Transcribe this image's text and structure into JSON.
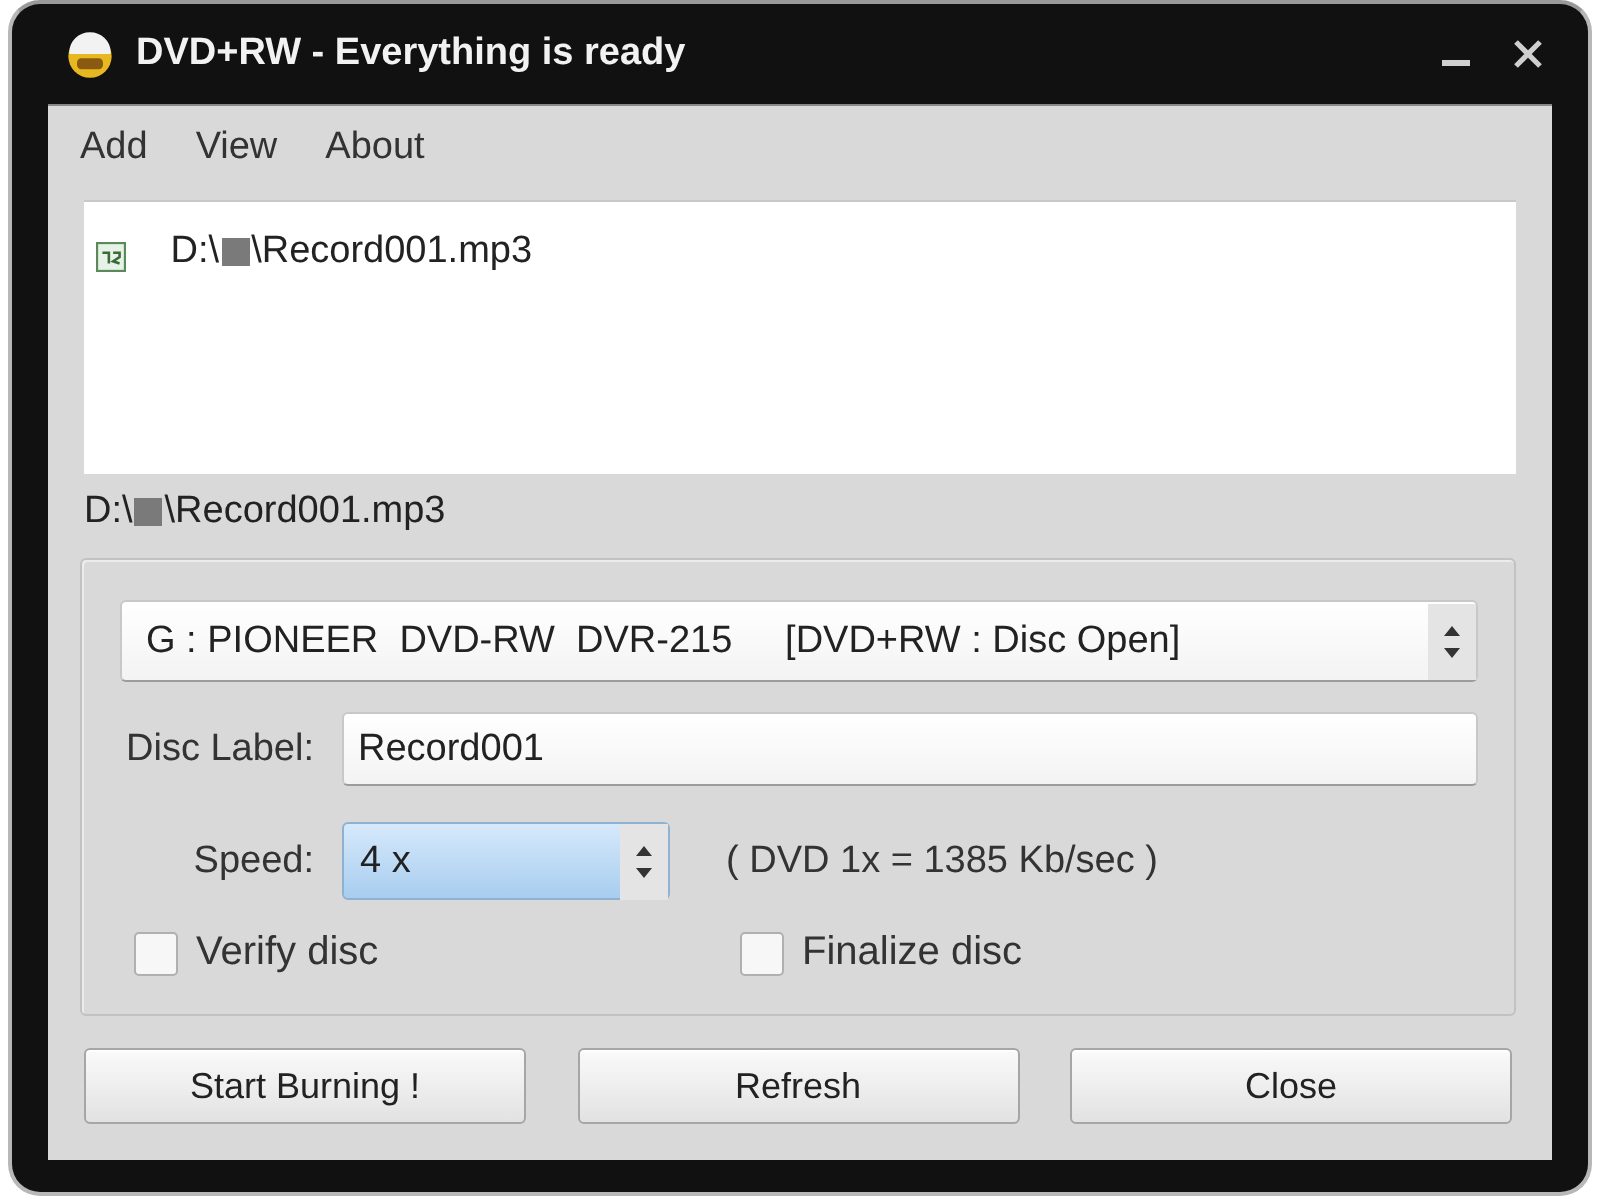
{
  "window": {
    "title": "DVD+RW - Everything is ready"
  },
  "menu": [
    {
      "label": "Add"
    },
    {
      "label": "View"
    },
    {
      "label": "About"
    }
  ],
  "file_list": {
    "items": [
      {
        "path_start": "D:\\",
        "path_end": "\\Record001.mp3",
        "selected": false
      }
    ]
  },
  "status_path": {
    "path_start": "D:\\",
    "path_end": "\\Record001.mp3"
  },
  "drive": {
    "value": "G : PIONEER  DVD-RW  DVR-215     [DVD+RW : Disc Open]"
  },
  "disc_label": {
    "label": "Disc Label:",
    "value": "Record001"
  },
  "speed": {
    "label": "Speed:",
    "value": "4 x",
    "highlighted": true,
    "note": "( DVD 1x = 1385 Kb/sec )"
  },
  "options": [
    {
      "label": "Verify disc",
      "checked": false
    },
    {
      "label": "Finalize disc",
      "checked": false
    }
  ],
  "buttons": [
    "Start Burning !",
    "Refresh",
    "Close"
  ]
}
